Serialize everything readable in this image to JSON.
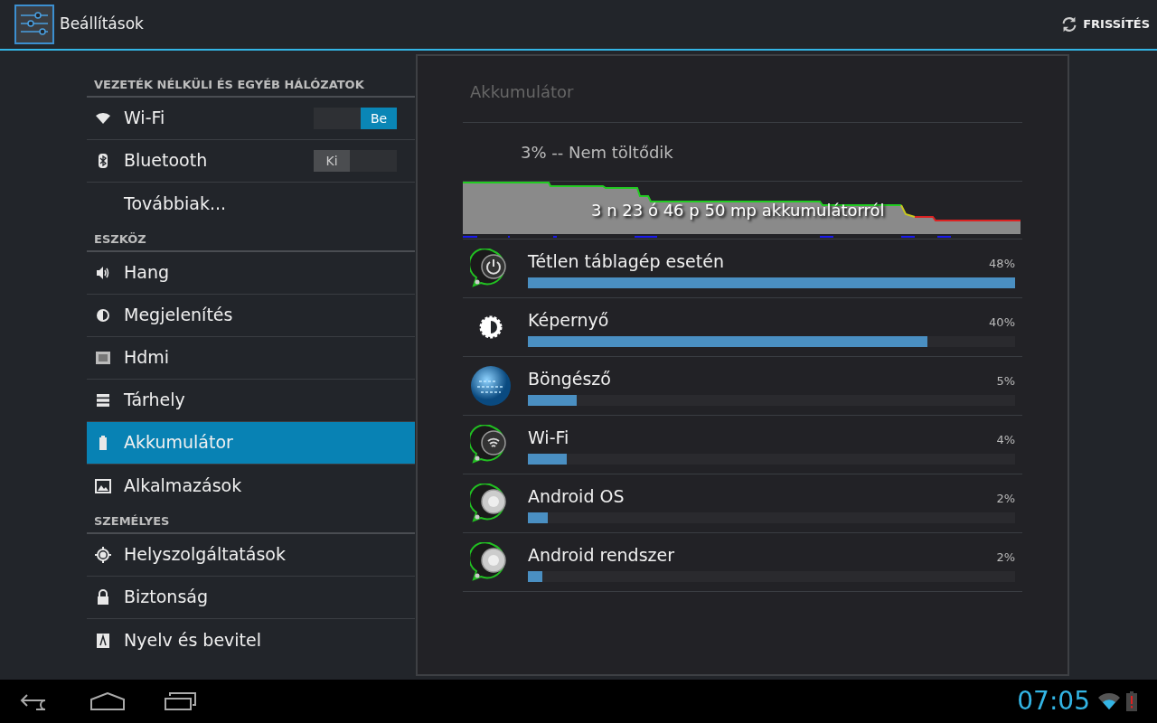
{
  "action_bar": {
    "title": "Beállítások",
    "refresh_label": "FRISSÍTÉS"
  },
  "sidebar": {
    "items": [
      {
        "kind": "header",
        "label": "VEZETÉK NÉLKÜLI ÉS EGYÉB HÁLÓZATOK"
      },
      {
        "kind": "item",
        "label": "Wi-Fi",
        "selected": false,
        "toggle": {
          "label": "Be",
          "on": true
        }
      },
      {
        "kind": "item",
        "label": "Bluetooth",
        "selected": false,
        "toggle": {
          "label": "Ki",
          "on": false
        }
      },
      {
        "kind": "item",
        "label": "Továbbiak...",
        "selected": false
      },
      {
        "kind": "header",
        "label": "ESZKÖZ"
      },
      {
        "kind": "item",
        "label": "Hang",
        "selected": false
      },
      {
        "kind": "item",
        "label": "Megjelenítés",
        "selected": false
      },
      {
        "kind": "item",
        "label": "Hdmi",
        "selected": false
      },
      {
        "kind": "item",
        "label": "Tárhely",
        "selected": false
      },
      {
        "kind": "item",
        "label": "Akkumulátor",
        "selected": true
      },
      {
        "kind": "item",
        "label": "Alkalmazások",
        "selected": false
      },
      {
        "kind": "header",
        "label": "SZEMÉLYES"
      },
      {
        "kind": "item",
        "label": "Helyszolgáltatások",
        "selected": false
      },
      {
        "kind": "item",
        "label": "Biztonság",
        "selected": false
      },
      {
        "kind": "item",
        "label": "Nyelv és bevitel",
        "selected": false
      }
    ]
  },
  "panel": {
    "title": "Akkumulátor",
    "status": "3% -- Nem töltődik",
    "graph_caption": "3 n 23 ó 46 p 50 mp akkumulátorról",
    "usage": [
      {
        "name": "Tétlen táblagép esetén",
        "percent": "48%",
        "level": 1.0
      },
      {
        "name": "Képernyő",
        "percent": "40%",
        "level": 0.82
      },
      {
        "name": "Böngésző",
        "percent": "5%",
        "level": 0.1
      },
      {
        "name": "Wi-Fi",
        "percent": "4%",
        "level": 0.08
      },
      {
        "name": "Android OS",
        "percent": "2%",
        "level": 0.04
      },
      {
        "name": "Android rendszer",
        "percent": "2%",
        "level": 0.03
      }
    ]
  },
  "status_bar": {
    "time": "07:05"
  }
}
